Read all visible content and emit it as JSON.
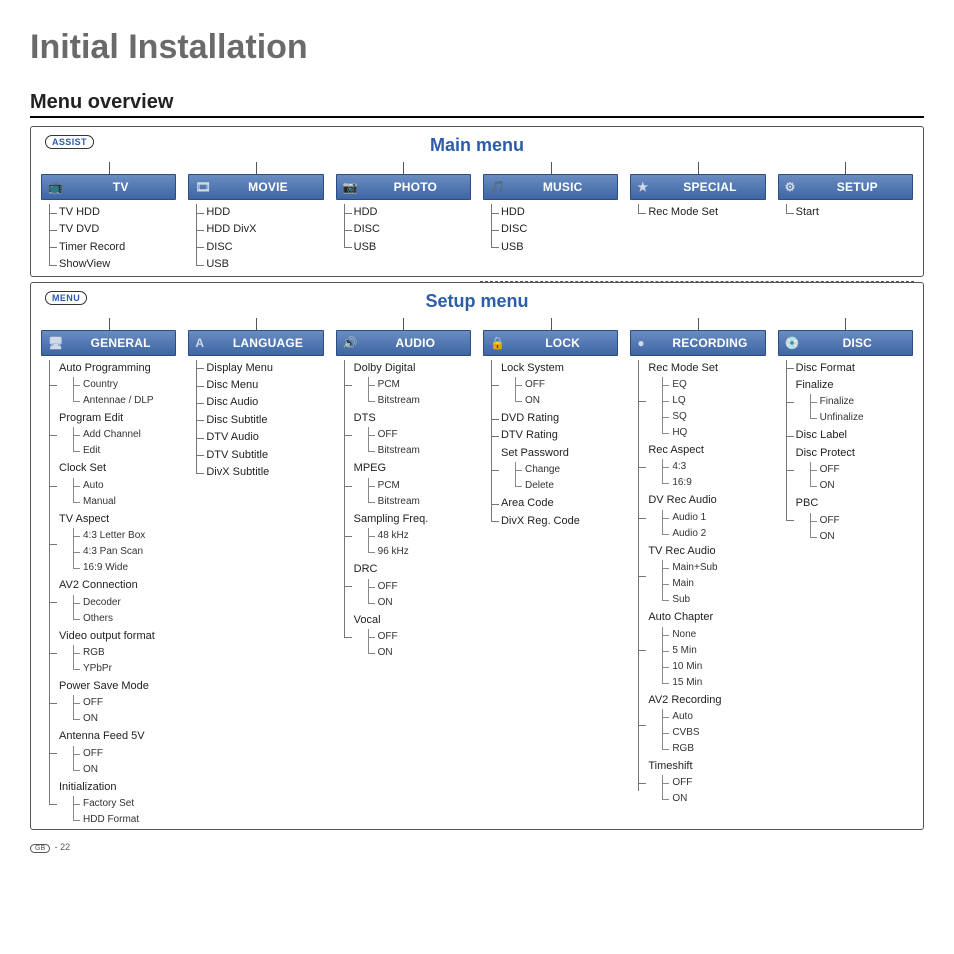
{
  "page_title": "Initial Installation",
  "section_title": "Menu overview",
  "main_menu": {
    "label": "Main menu",
    "assist": "ASSIST",
    "tabs": [
      {
        "title": "TV",
        "items": [
          "TV HDD",
          "TV DVD",
          "Timer Record",
          "ShowView"
        ]
      },
      {
        "title": "MOVIE",
        "items": [
          "HDD",
          "HDD DivX",
          "DISC",
          "USB"
        ]
      },
      {
        "title": "PHOTO",
        "items": [
          "HDD",
          "DISC",
          "USB"
        ]
      },
      {
        "title": "MUSIC",
        "items": [
          "HDD",
          "DISC",
          "USB"
        ]
      },
      {
        "title": "SPECIAL",
        "items": [
          "Rec Mode Set"
        ]
      },
      {
        "title": "SETUP",
        "items": [
          "Start"
        ]
      }
    ]
  },
  "setup_menu": {
    "label": "Setup menu",
    "menu_pill": "MENU",
    "tabs": [
      {
        "title": "General",
        "items": [
          {
            "t": "Auto Programming",
            "c": [
              "Country",
              "Antennae / DLP"
            ]
          },
          {
            "t": "Program Edit",
            "c": [
              "Add Channel",
              "Edit"
            ]
          },
          {
            "t": "Clock Set",
            "c": [
              "Auto",
              "Manual"
            ]
          },
          {
            "t": "TV Aspect",
            "c": [
              "4:3 Letter Box",
              "4:3 Pan Scan",
              "16:9 Wide"
            ]
          },
          {
            "t": "AV2 Connection",
            "c": [
              "Decoder",
              "Others"
            ]
          },
          {
            "t": "Video output format",
            "c": [
              "RGB",
              "YPbPr"
            ]
          },
          {
            "t": "Power Save Mode",
            "c": [
              "OFF",
              "ON"
            ]
          },
          {
            "t": "Antenna Feed 5V",
            "c": [
              "OFF",
              "ON"
            ]
          },
          {
            "t": "Initialization",
            "c": [
              "Factory Set",
              "HDD Format"
            ]
          }
        ]
      },
      {
        "title": "Language",
        "items": [
          {
            "t": "Display Menu"
          },
          {
            "t": "Disc Menu"
          },
          {
            "t": "Disc Audio"
          },
          {
            "t": "Disc Subtitle"
          },
          {
            "t": "DTV Audio"
          },
          {
            "t": "DTV Subtitle"
          },
          {
            "t": "DivX Subtitle"
          }
        ]
      },
      {
        "title": "Audio",
        "items": [
          {
            "t": "Dolby Digital",
            "c": [
              "PCM",
              "Bitstream"
            ]
          },
          {
            "t": "DTS",
            "c": [
              "OFF",
              "Bitstream"
            ]
          },
          {
            "t": "MPEG",
            "c": [
              "PCM",
              "Bitstream"
            ]
          },
          {
            "t": "Sampling Freq.",
            "c": [
              "48 kHz",
              "96 kHz"
            ]
          },
          {
            "t": "DRC",
            "c": [
              "OFF",
              "ON"
            ]
          },
          {
            "t": "Vocal",
            "c": [
              "OFF",
              "ON"
            ]
          }
        ]
      },
      {
        "title": "Lock",
        "items": [
          {
            "t": "Lock System",
            "c": [
              "OFF",
              "ON"
            ]
          },
          {
            "t": "DVD Rating"
          },
          {
            "t": "DTV Rating"
          },
          {
            "t": "Set Password",
            "c": [
              "Change",
              "Delete"
            ]
          },
          {
            "t": "Area Code"
          },
          {
            "t": "DivX Reg. Code"
          }
        ]
      },
      {
        "title": "Recording",
        "items": [
          {
            "t": "Rec Mode Set",
            "c": [
              "EQ",
              "LQ",
              "SQ",
              "HQ"
            ]
          },
          {
            "t": "Rec Aspect",
            "c": [
              "4:3",
              "16:9"
            ]
          },
          {
            "t": "DV Rec Audio",
            "c": [
              "Audio 1",
              "Audio 2"
            ]
          },
          {
            "t": "TV Rec Audio",
            "c": [
              "Main+Sub",
              "Main",
              "Sub"
            ]
          },
          {
            "t": "Auto Chapter",
            "c": [
              "None",
              "5 Min",
              "10 Min",
              "15 Min"
            ]
          },
          {
            "t": "AV2 Recording",
            "c": [
              "Auto",
              "CVBS",
              "RGB"
            ]
          },
          {
            "t": "Timeshift",
            "c": [
              "OFF",
              "ON"
            ]
          }
        ]
      },
      {
        "title": "Disc",
        "items": [
          {
            "t": "Disc Format"
          },
          {
            "t": "Finalize",
            "c": [
              "Finalize",
              "Unfinalize"
            ]
          },
          {
            "t": "Disc Label"
          },
          {
            "t": "Disc Protect",
            "c": [
              "OFF",
              "ON"
            ]
          },
          {
            "t": "PBC",
            "c": [
              "OFF",
              "ON"
            ]
          }
        ]
      }
    ]
  },
  "footer": {
    "region": "GB",
    "page": "- 22"
  },
  "icons": {
    "tv": "📺",
    "movie": "🎞",
    "photo": "📷",
    "music": "🎵",
    "special": "★",
    "setup": "⚙",
    "general": "🖥",
    "language": "A",
    "audio": "🔊",
    "lock": "🔒",
    "recording": "●",
    "disc": "💿"
  }
}
